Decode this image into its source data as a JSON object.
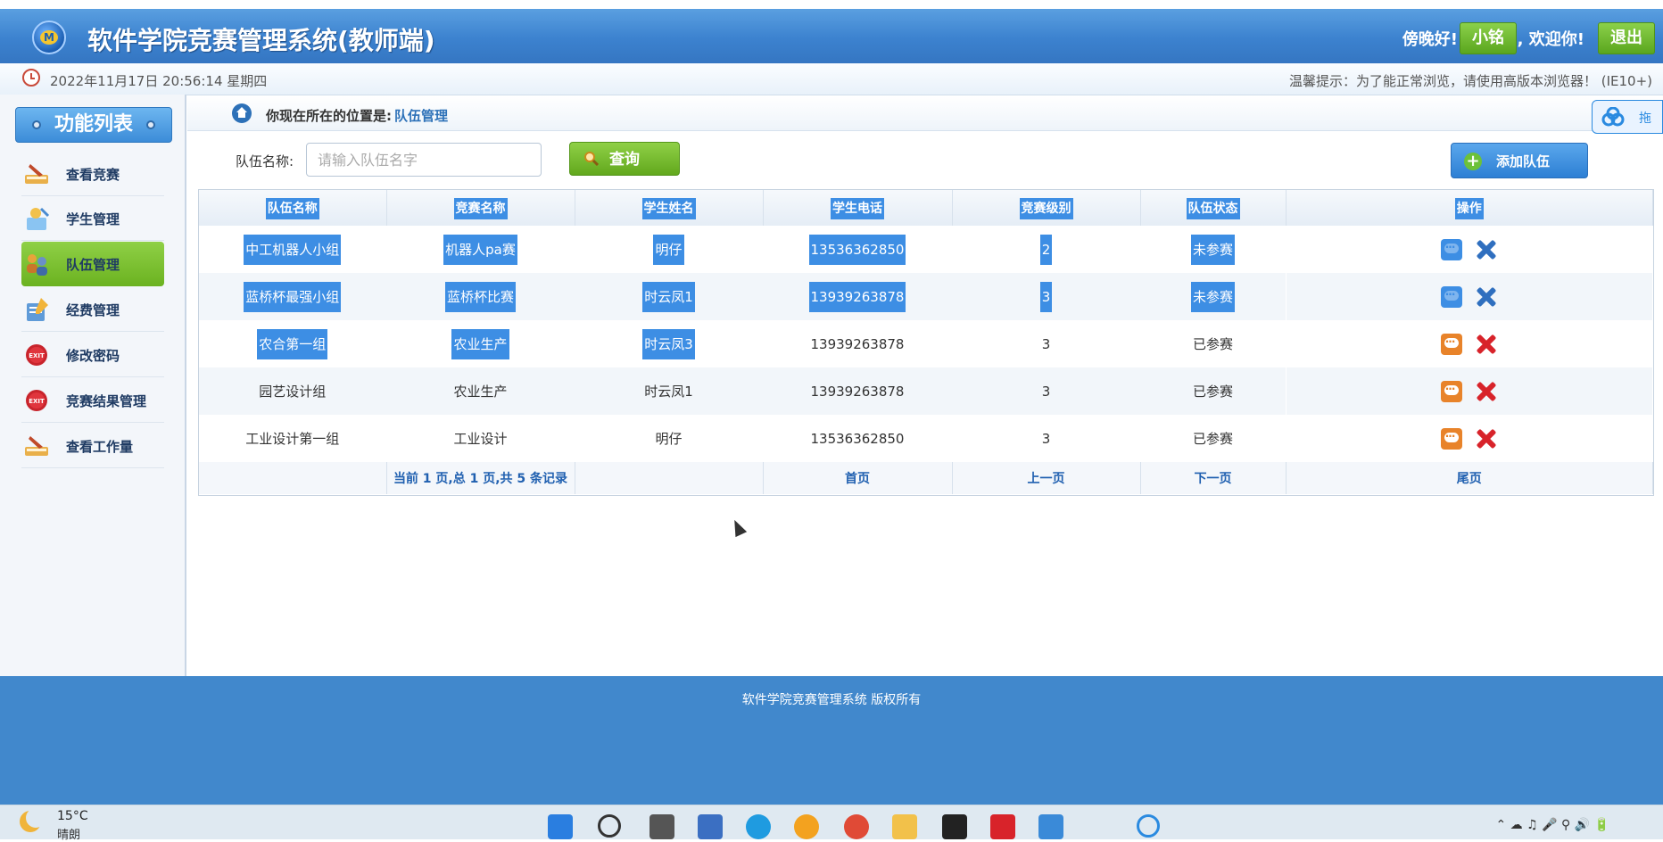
{
  "header": {
    "title": "软件学院竞赛管理系统(教师端)",
    "greeting": "傍晚好!",
    "username": "小铭",
    "welcome": ", 欢迎你!",
    "logout_label": "退出"
  },
  "infobar": {
    "datetime": "2022年11月17日 20:56:14 星期四",
    "tip": "温馨提示：为了能正常浏览，请使用高版本浏览器！   (IE10+)"
  },
  "sidebar": {
    "title": "功能列表",
    "items": [
      {
        "label": "查看竞赛"
      },
      {
        "label": "学生管理"
      },
      {
        "label": "队伍管理"
      },
      {
        "label": "经费管理"
      },
      {
        "label": "修改密码"
      },
      {
        "label": "竞赛结果管理"
      },
      {
        "label": "查看工作量"
      }
    ]
  },
  "breadcrumb": {
    "label": "你现在所在的位置是:",
    "current": "队伍管理"
  },
  "search": {
    "label": "队伍名称:",
    "placeholder": "请输入队伍名字",
    "value": "",
    "button_label": "查询"
  },
  "add_button_label": "添加队伍",
  "table": {
    "headers": [
      "队伍名称",
      "竞赛名称",
      "学生姓名",
      "学生电话",
      "竞赛级别",
      "队伍状态",
      "操作"
    ],
    "rows": [
      [
        "中工机器人小组",
        "机器人pa赛",
        "明仔",
        "13536362850",
        "2",
        "未参赛"
      ],
      [
        "蓝桥杯最强小组",
        "蓝桥杯比赛",
        "时云凤1",
        "13939263878",
        "3",
        "未参赛"
      ],
      [
        "农合第一组",
        "农业生产",
        "时云凤3",
        "13939263878",
        "3",
        "已参赛"
      ],
      [
        "园艺设计组",
        "农业生产",
        "时云凤1",
        "13939263878",
        "3",
        "已参赛"
      ],
      [
        "工业设计第一组",
        "工业设计",
        "明仔",
        "13536362850",
        "3",
        "已参赛"
      ]
    ]
  },
  "pager": {
    "summary": "当前 1 页,总 1 页,共 5 条记录",
    "first": "首页",
    "prev": "上一页",
    "next": "下一页",
    "last": "尾页"
  },
  "footer": {
    "text": "软件学院竞赛管理系统 版权所有"
  },
  "taskbar": {
    "temp": "15°C",
    "weather": "晴朗"
  },
  "colors": {
    "header_blue": "#3c82cf",
    "accent_green": "#6bb220",
    "selection_blue": "#3d8ee4",
    "footer_blue": "#4188cc",
    "delete_red": "#d8232a"
  }
}
